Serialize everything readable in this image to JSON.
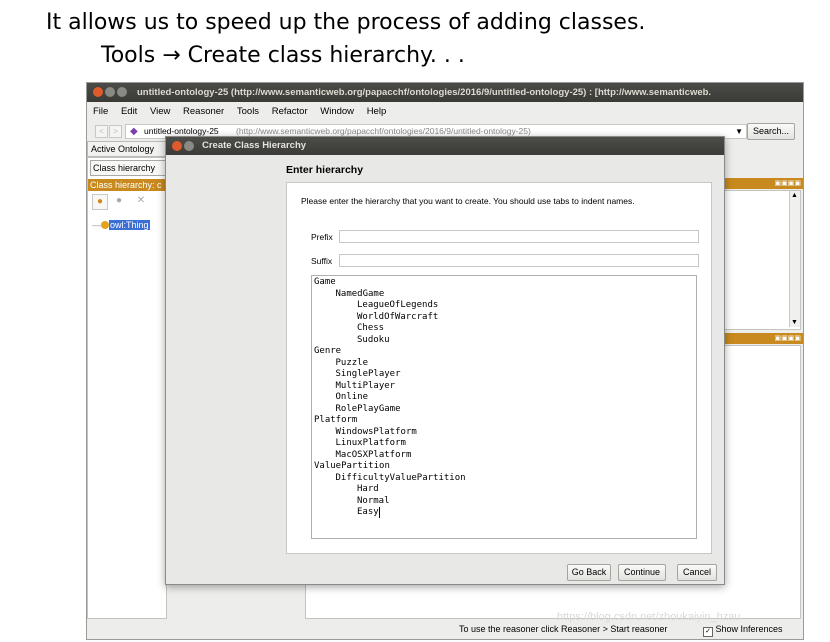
{
  "slide": {
    "line1": "It allows us to speed up the process of adding classes.",
    "line2": "Tools → Create class hierarchy. . ."
  },
  "window": {
    "title": "untitled-ontology-25 (http://www.semanticweb.org/papacchf/ontologies/2016/9/untitled-ontology-25)  : [http://www.semanticweb.",
    "menu": [
      "File",
      "Edit",
      "View",
      "Reasoner",
      "Tools",
      "Refactor",
      "Window",
      "Help"
    ],
    "ontology_name": "untitled-ontology-25",
    "ontology_iri": "(http://www.semanticweb.org/papacchf/ontologies/2016/9/untitled-ontology-25)",
    "search_label": "Search...",
    "active_tab": "Active Ontology",
    "class_tab": "Class hierarchy",
    "class_panel_label": "Class hierarchy: c",
    "root_class": "owl:Thing",
    "status_text": "To use the reasoner click Reasoner > Start reasoner",
    "show_inferences": "Show Inferences",
    "watermark": "https://blog.csdn.net/zhoukaiyin_hzau"
  },
  "dialog": {
    "title": "Create Class Hierarchy",
    "heading": "Enter hierarchy",
    "instructions": "Please enter the hierarchy that you want to create.  You should use tabs to indent names.",
    "prefix_label": "Prefix",
    "prefix_value": "",
    "suffix_label": "Suffix",
    "suffix_value": "",
    "hierarchy_lines": [
      {
        "text": "Game",
        "level": 0
      },
      {
        "text": "NamedGame",
        "level": 1
      },
      {
        "text": "LeagueOfLegends",
        "level": 2
      },
      {
        "text": "WorldOfWarcraft",
        "level": 2
      },
      {
        "text": "Chess",
        "level": 2
      },
      {
        "text": "Sudoku",
        "level": 2
      },
      {
        "text": "Genre",
        "level": 0
      },
      {
        "text": "Puzzle",
        "level": 1
      },
      {
        "text": "SinglePlayer",
        "level": 1
      },
      {
        "text": "MultiPlayer",
        "level": 1
      },
      {
        "text": "Online",
        "level": 1
      },
      {
        "text": "RolePlayGame",
        "level": 1
      },
      {
        "text": "Platform",
        "level": 0
      },
      {
        "text": "WindowsPlatform",
        "level": 1
      },
      {
        "text": "LinuxPlatform",
        "level": 1
      },
      {
        "text": "MacOSXPlatform",
        "level": 1
      },
      {
        "text": "ValuePartition",
        "level": 0
      },
      {
        "text": "DifficultyValuePartition",
        "level": 1
      },
      {
        "text": "Hard",
        "level": 2
      },
      {
        "text": "Normal",
        "level": 2
      },
      {
        "text": "Easy",
        "level": 2
      }
    ],
    "buttons": {
      "back": "Go Back",
      "continue": "Continue",
      "cancel": "Cancel"
    }
  },
  "colors": {
    "orange": "#c88a1e",
    "title_bar": "#3d3d39",
    "close_button": "#e05a2b",
    "selection": "#3b6fd6"
  }
}
